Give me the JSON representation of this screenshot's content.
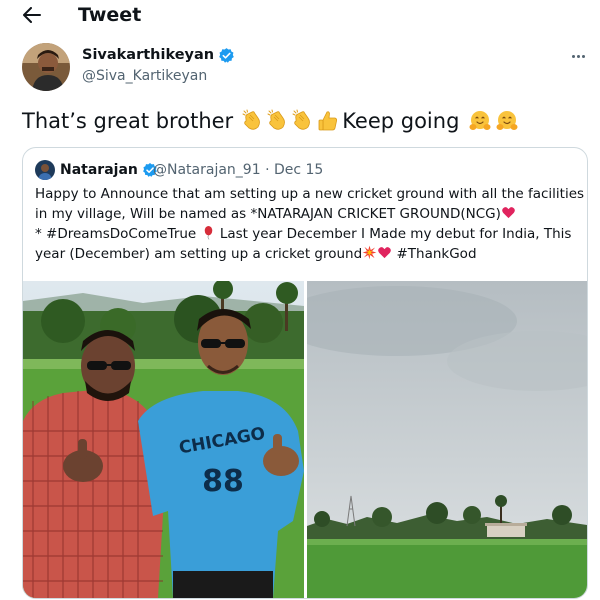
{
  "header": {
    "title": "Tweet"
  },
  "tweet": {
    "author_name": "Sivakarthikeyan",
    "author_handle": "@Siva_Kartikeyan",
    "text_main": "That’s great brother",
    "text_after": "Keep going",
    "emojis": [
      "clapping-hands",
      "clapping-hands",
      "clapping-hands",
      "thumbs-up",
      "hugging-face",
      "hugging-face"
    ]
  },
  "quoted_tweet": {
    "author_name": "Natarajan",
    "author_handle": "@Natarajan_91",
    "separator": " · ",
    "date": "Dec 15",
    "line1": "Happy to Announce that am setting up a new cricket ground with all the facilities",
    "line2": "in my village, Will be  named as *NATARAJAN CRICKET GROUND(NCG)",
    "line3a": "* #DreamsDoComeTrue ",
    "line3b": " Last year December I Made my debut for India, This",
    "line4a": "year (December) am setting up a cricket ground",
    "line4b": " #ThankGod",
    "shirt_text": "CHICAGO",
    "shirt_number": "88"
  },
  "colors": {
    "verified": "#1d9bf0",
    "secondary_text": "#536471",
    "border": "#cfd9de",
    "heart": "#e0245e"
  }
}
